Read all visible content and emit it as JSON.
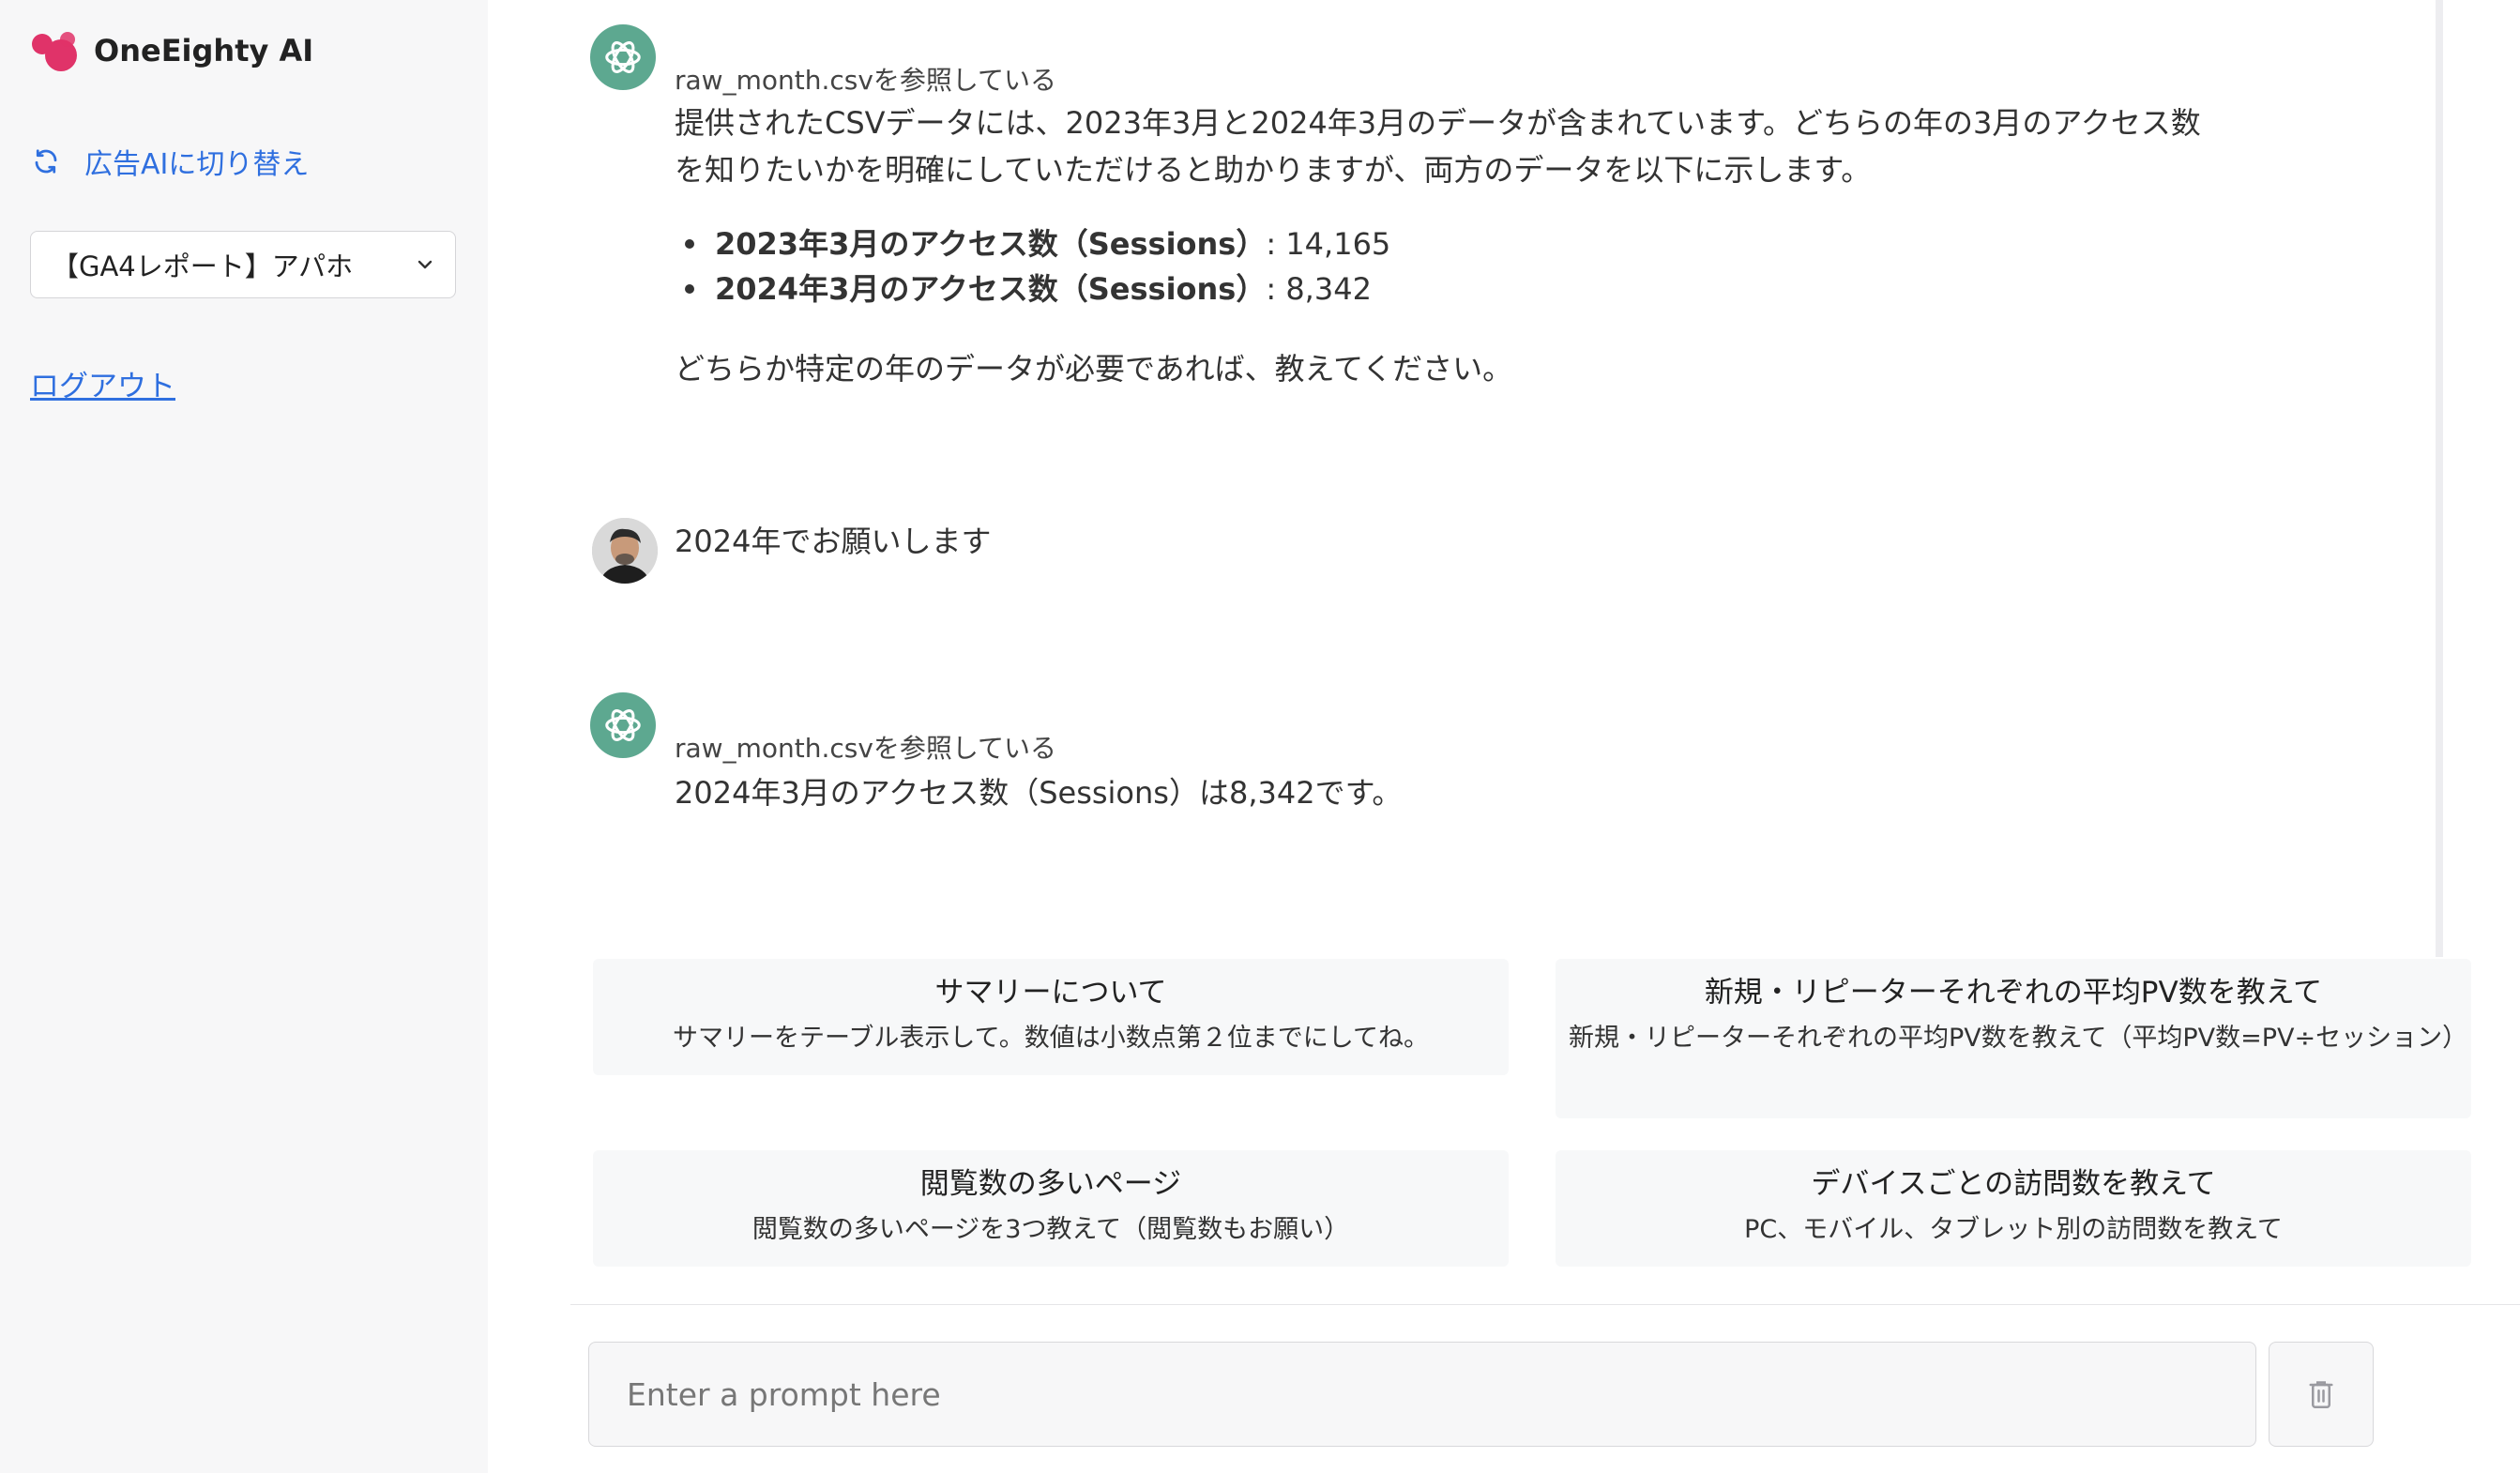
{
  "sidebar": {
    "brand": "OneEighty AI",
    "switch_label": "広告AIに切り替え",
    "report_select": "【GA4レポート】アパホ",
    "logout": "ログアウト"
  },
  "chat": {
    "messages": [
      {
        "role": "assistant",
        "reference": "raw_month.csvを参照している",
        "line1": "提供されたCSVデータには、2023年3月と2024年3月のデータが含まれています。どちらの年の3月のアクセス数",
        "line2": "を知りたいかを明確にしていただけると助かりますが、両方のデータを以下に示します。",
        "bullets": [
          {
            "label": "2023年3月のアクセス数（Sessions）",
            "value": ": 14,165"
          },
          {
            "label": "2024年3月のアクセス数（Sessions）",
            "value": ": 8,342"
          }
        ],
        "closing": "どちらか特定の年のデータが必要であれば、教えてください。"
      },
      {
        "role": "user",
        "text": "2024年でお願いします"
      },
      {
        "role": "assistant",
        "reference": "raw_month.csvを参照している",
        "text": "2024年3月のアクセス数（Sessions）は8,342です。"
      }
    ]
  },
  "suggestions": [
    {
      "title": "サマリーについて",
      "desc": "サマリーをテーブル表示して。数値は小数点第２位までにしてね。"
    },
    {
      "title": "新規・リピーターそれぞれの平均PV数を教えて",
      "desc": "新規・リピーターそれぞれの平均PV数を教えて（平均PV数=PV÷セッション）"
    },
    {
      "title": "閲覧数の多いページ",
      "desc": "閲覧数の多いページを3つ教えて（閲覧数もお願い）"
    },
    {
      "title": "デバイスごとの訪問数を教えて",
      "desc": "PC、モバイル、タブレット別の訪問数を教えて"
    }
  ],
  "composer": {
    "placeholder": "Enter a prompt here"
  },
  "colors": {
    "brand": "#e03369",
    "link": "#2f6fdf",
    "bot_avatar": "#5da890"
  }
}
